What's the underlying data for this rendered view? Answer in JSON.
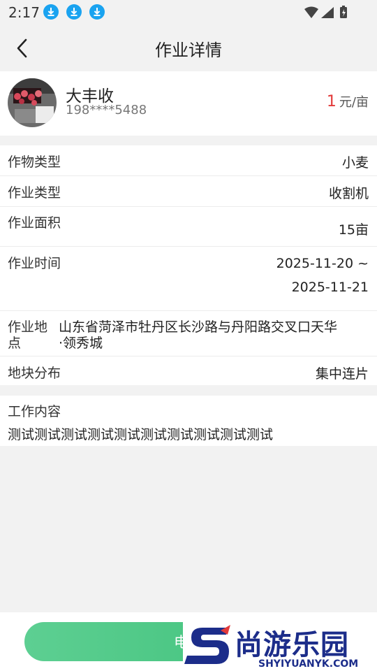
{
  "status_bar": {
    "time": "2:17"
  },
  "header": {
    "title": "作业详情"
  },
  "user": {
    "name": "大丰收",
    "phone": "198****5488",
    "price_value": "1",
    "price_unit": "元/亩"
  },
  "details": [
    {
      "label": "作物类型",
      "value": "小麦"
    },
    {
      "label": "作业类型",
      "value": "收割机"
    },
    {
      "label": "作业面积",
      "value": "15亩"
    },
    {
      "label": "作业时间",
      "value_line1": "2025-11-20 ~",
      "value_line2": "2025-11-21"
    },
    {
      "label_line1": "作业地",
      "label_line2": "点",
      "value_line1": "山东省菏泽市牡丹区长沙路与丹阳路交叉口天华",
      "value_line2": "·领秀城"
    },
    {
      "label": "地块分布",
      "value": "集中连片"
    }
  ],
  "work_content": {
    "label": "工作内容",
    "text": "测试测试测试测试测试测试测试测试测试测试"
  },
  "bottom": {
    "call_label": "电话"
  },
  "watermark": {
    "cn": "尚游乐园",
    "en": "SHYIYUANYK.COM"
  },
  "colors": {
    "accent_green": "#3bbf77",
    "price_red": "#e23a3a",
    "download_blue": "#1aa3f0",
    "watermark_blue": "#1c2d8a"
  }
}
